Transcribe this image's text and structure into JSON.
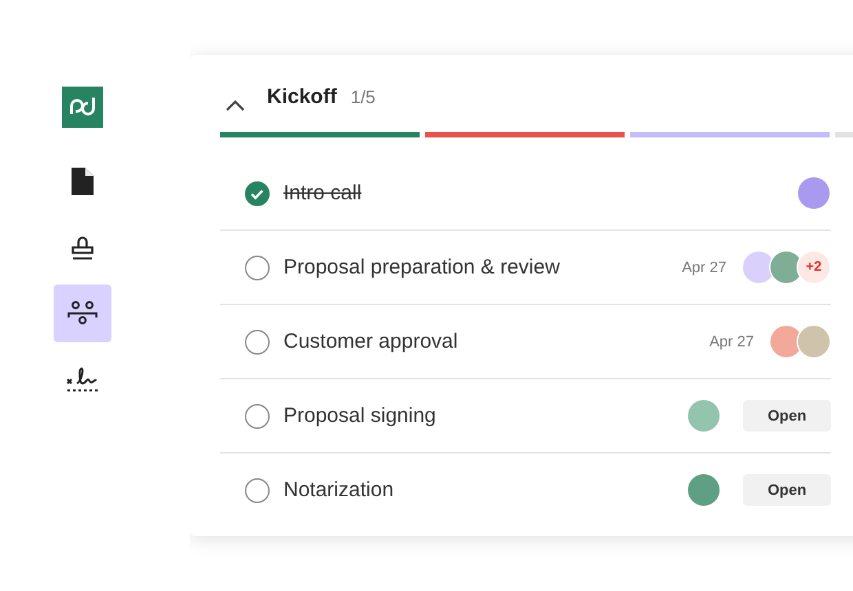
{
  "sidebar": {
    "items": [
      {
        "kind": "document",
        "selected": false
      },
      {
        "kind": "stamp",
        "selected": false
      },
      {
        "kind": "fields",
        "selected": true
      },
      {
        "kind": "signature",
        "selected": false
      }
    ]
  },
  "section": {
    "title": "Kickoff",
    "count": "1/5",
    "expanded": true,
    "progress": [
      {
        "color": "#268463"
      },
      {
        "color": "#e8524a"
      },
      {
        "color": "#c5bdfb"
      },
      {
        "color": "#e2e2e2"
      }
    ],
    "tasks": [
      {
        "name": "Intro call",
        "checked": true,
        "avatars": [
          {
            "color": "#a99af0"
          }
        ]
      },
      {
        "name": "Proposal preparation & review",
        "checked": false,
        "date": "Apr 27",
        "avatars": [
          {
            "color": "#d9d1fb"
          },
          {
            "color": "#7fae96"
          }
        ],
        "more": "+2"
      },
      {
        "name": "Customer approval",
        "checked": false,
        "date": "Apr 27",
        "avatars": [
          {
            "color": "#f2a99a"
          },
          {
            "color": "#cfc3ab"
          }
        ]
      },
      {
        "name": "Proposal signing",
        "checked": false,
        "avatars": [
          {
            "color": "#92c4ae"
          }
        ],
        "action": "Open"
      },
      {
        "name": "Notarization",
        "checked": false,
        "avatars": [
          {
            "color": "#5f9f83"
          }
        ],
        "action": "Open"
      }
    ]
  }
}
